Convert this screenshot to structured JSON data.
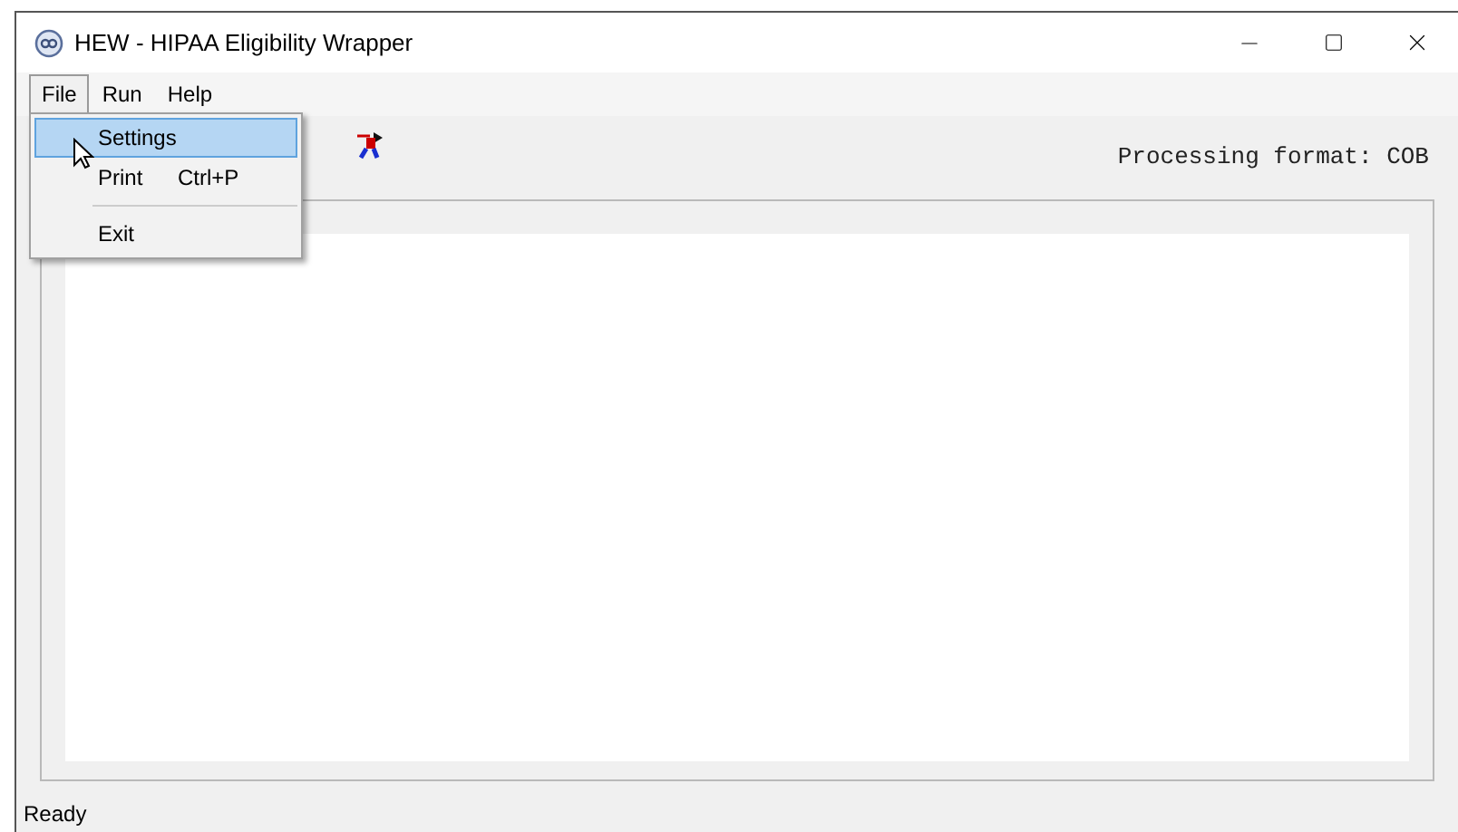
{
  "window": {
    "title": "HEW - HIPAA Eligibility Wrapper"
  },
  "menu_bar": [
    {
      "label": "File",
      "selected": true
    },
    {
      "label": "Run",
      "selected": false
    },
    {
      "label": "Help",
      "selected": false
    }
  ],
  "file_menu": [
    {
      "kind": "item",
      "label": "Settings",
      "selected": true
    },
    {
      "kind": "item",
      "label": "Print",
      "shortcut": "Ctrl+P",
      "selected": false
    },
    {
      "kind": "separator"
    },
    {
      "kind": "item",
      "label": "Exit",
      "selected": false
    }
  ],
  "toolbar": {
    "format_label": "Processing format: COB"
  },
  "status_bar": "Ready"
}
